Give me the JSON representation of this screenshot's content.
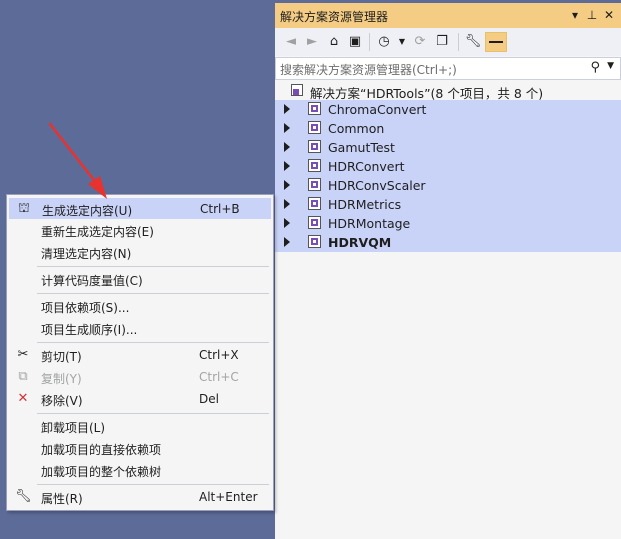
{
  "panel": {
    "title": "解决方案资源管理器",
    "title_buttons": [
      "▾",
      "⊥",
      "✕"
    ],
    "search_placeholder": "搜索解决方案资源管理器(Ctrl+;)",
    "solution_label": "解决方案“HDRTools”(8 个项目，共 8 个)",
    "projects": [
      {
        "name": "ChromaConvert",
        "bold": false
      },
      {
        "name": "Common",
        "bold": false
      },
      {
        "name": "GamutTest",
        "bold": false
      },
      {
        "name": "HDRConvert",
        "bold": false
      },
      {
        "name": "HDRConvScaler",
        "bold": false
      },
      {
        "name": "HDRMetrics",
        "bold": false
      },
      {
        "name": "HDRMontage",
        "bold": false
      },
      {
        "name": "HDRVQM",
        "bold": true
      }
    ]
  },
  "menu": {
    "items": [
      {
        "label": "生成选定内容(U)",
        "key": "Ctrl+B",
        "icon": "build-icon",
        "highlighted": true
      },
      {
        "label": "重新生成选定内容(E)",
        "key": ""
      },
      {
        "label": "清理选定内容(N)",
        "key": ""
      },
      {
        "label": "计算代码度量值(C)",
        "key": ""
      },
      {
        "label": "项目依赖项(S)...",
        "key": ""
      },
      {
        "label": "项目生成顺序(I)...",
        "key": ""
      },
      {
        "label": "剪切(T)",
        "key": "Ctrl+X",
        "icon": "scissors-icon"
      },
      {
        "label": "复制(Y)",
        "key": "Ctrl+C",
        "icon": "copy-icon",
        "disabled": true
      },
      {
        "label": "移除(V)",
        "key": "Del",
        "icon": "remove-icon"
      },
      {
        "label": "卸载项目(L)",
        "key": ""
      },
      {
        "label": "加载项目的直接依赖项",
        "key": ""
      },
      {
        "label": "加载项目的整个依赖树",
        "key": ""
      },
      {
        "label": "属性(R)",
        "key": "Alt+Enter",
        "icon": "wrench-icon"
      }
    ]
  },
  "colors": {
    "background": "#5d6b99",
    "title_bar": "#f5cc84",
    "selection": "#c9d3f7",
    "arrow": "#e8322e"
  }
}
